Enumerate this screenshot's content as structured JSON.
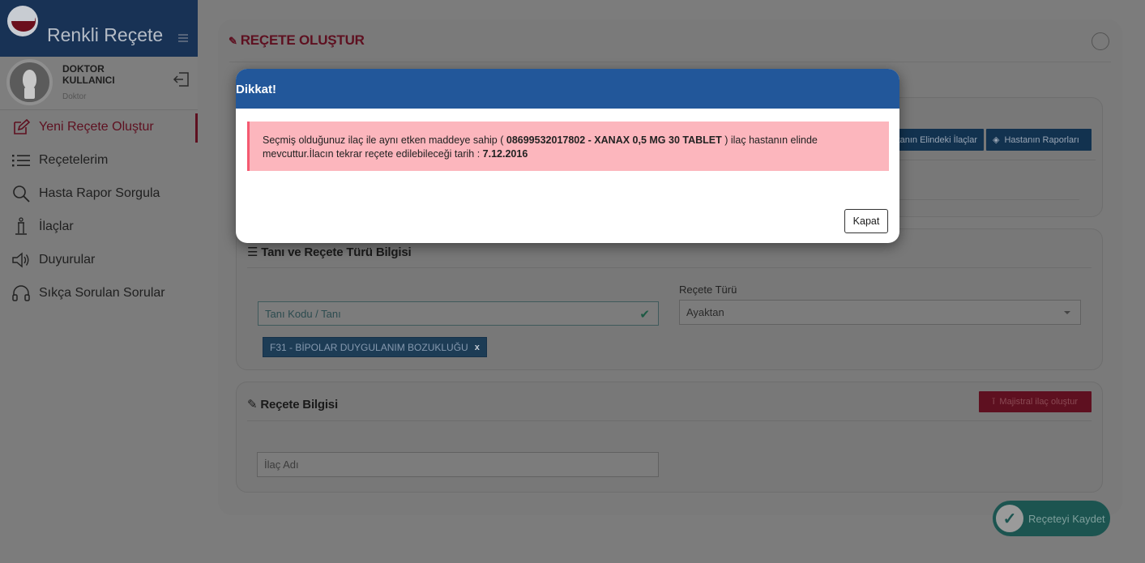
{
  "app": {
    "title": "Renkli Reçete"
  },
  "profile": {
    "name": "DOKTOR KULLANICI",
    "role": "Doktor"
  },
  "sidebar": {
    "items": [
      {
        "label": "Yeni Reçete Oluştur",
        "icon": "edit-icon",
        "active": true
      },
      {
        "label": "Reçetelerim",
        "icon": "list-icon"
      },
      {
        "label": "Hasta Rapor Sorgula",
        "icon": "search-icon"
      },
      {
        "label": "İlaçlar",
        "icon": "pill-bottle-icon"
      },
      {
        "label": "Duyurular",
        "icon": "speaker-icon"
      },
      {
        "label": "Sıkça Sorulan Sorular",
        "icon": "headset-icon"
      }
    ]
  },
  "page": {
    "title": "REÇETE OLUŞTUR"
  },
  "patient": {
    "buttons": {
      "elindeki": "Hastanın Elindeki İlaçlar",
      "raporlar": "Hastanın Raporları"
    }
  },
  "tani": {
    "title": "Tanı ve Reçete Türü Bilgisi",
    "tani_placeholder": "Tanı Kodu / Tanı",
    "recete_turu_label": "Reçete Türü",
    "recete_turu_value": "Ayaktan",
    "selected_tag": "F31 - BİPOLAR DUYGULANIM BOZUKLUĞU",
    "tag_remove": "x"
  },
  "recete": {
    "title": "Reçete Bilgisi",
    "majistral_button": "Majistral ilaç oluştur",
    "ilac_placeholder": "İlaç Adı"
  },
  "save_button": "Reçeteyi Kaydet",
  "modal": {
    "title": "Dikkat!",
    "message_part1": "Seçmiş olduğunuz ilaç ile aynı etken maddeye sahip ( ",
    "drug": "08699532017802 - XANAX 0,5 MG 30 TABLET",
    "message_part2": " ) ilaç hastanın elinde mevcuttur.İlacın tekrar reçete edilebileceği tarih : ",
    "date": "7.12.2016",
    "close_label": "Kapat"
  },
  "colors": {
    "brand_dark": "#183255",
    "accent_red": "#5e1020",
    "modal_header": "#22579a",
    "alert_bg": "#fcb6bd",
    "alert_border": "#f55a72",
    "save_teal": "#1c5450"
  }
}
